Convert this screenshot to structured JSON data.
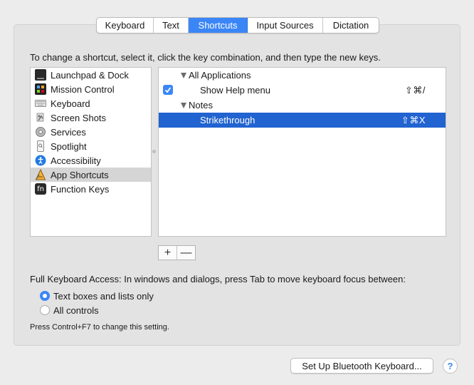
{
  "tabs": [
    {
      "label": "Keyboard",
      "active": false
    },
    {
      "label": "Text",
      "active": false
    },
    {
      "label": "Shortcuts",
      "active": true
    },
    {
      "label": "Input Sources",
      "active": false
    },
    {
      "label": "Dictation",
      "active": false
    }
  ],
  "instructions": "To change a shortcut, select it, click the key combination, and then type the new keys.",
  "categories": [
    {
      "label": "Launchpad & Dock",
      "icon": "launchpad-dock-icon"
    },
    {
      "label": "Mission Control",
      "icon": "mission-control-icon"
    },
    {
      "label": "Keyboard",
      "icon": "keyboard-icon"
    },
    {
      "label": "Screen Shots",
      "icon": "screenshot-icon"
    },
    {
      "label": "Services",
      "icon": "gear-icon"
    },
    {
      "label": "Spotlight",
      "icon": "spotlight-icon"
    },
    {
      "label": "Accessibility",
      "icon": "accessibility-icon"
    },
    {
      "label": "App Shortcuts",
      "icon": "app-shortcuts-icon",
      "selected": true
    },
    {
      "label": "Function Keys",
      "icon": "fn-icon",
      "icon_text": "fn"
    }
  ],
  "shortcuts": {
    "group1": {
      "label": "All Applications"
    },
    "item1": {
      "label": "Show Help menu",
      "keys": "⇧⌘/",
      "checked": true
    },
    "group2": {
      "label": "Notes"
    },
    "item2": {
      "label": "Strikethrough",
      "keys": "⇧⌘X",
      "selected": true
    }
  },
  "plus_label": "+",
  "minus_label": "—",
  "fka": {
    "label": "Full Keyboard Access: In windows and dialogs, press Tab to move keyboard focus between:",
    "options": [
      {
        "label": "Text boxes and lists only",
        "selected": true
      },
      {
        "label": "All controls",
        "selected": false
      }
    ],
    "note": "Press Control+F7 to change this setting."
  },
  "bluetooth_button": "Set Up Bluetooth Keyboard...",
  "help_label": "?",
  "colors": {
    "accent": "#3b86f7",
    "selection": "#2163d0"
  }
}
